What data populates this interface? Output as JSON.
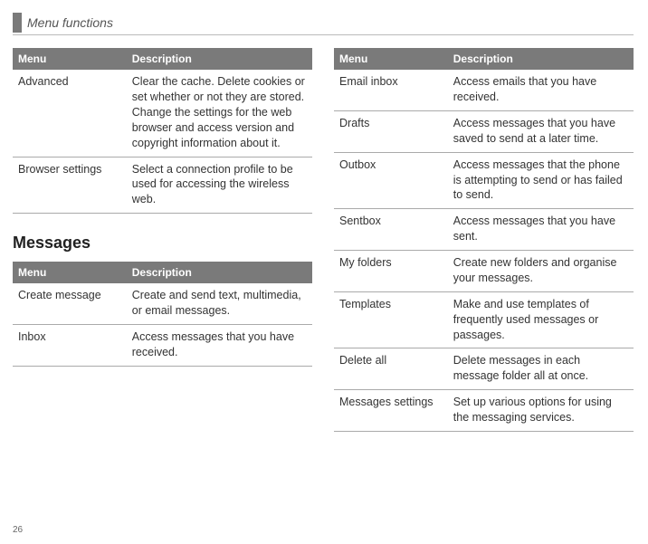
{
  "header": {
    "title": "Menu functions"
  },
  "page_number": "26",
  "table1": {
    "headers": {
      "menu": "Menu",
      "description": "Description"
    },
    "rows": [
      {
        "menu": "Advanced",
        "description": "Clear the cache. Delete cookies or set whether or not they are stored. Change the settings for the web browser and access version and copyright information about it."
      },
      {
        "menu": "Browser settings",
        "description": "Select a connection profile to be used for accessing the wireless web."
      }
    ]
  },
  "section_heading": "Messages",
  "table2": {
    "headers": {
      "menu": "Menu",
      "description": "Description"
    },
    "rows": [
      {
        "menu": "Create message",
        "description": "Create and send text, multimedia, or email messages."
      },
      {
        "menu": "Inbox",
        "description": "Access messages that you have received."
      }
    ]
  },
  "table3": {
    "headers": {
      "menu": "Menu",
      "description": "Description"
    },
    "rows": [
      {
        "menu": "Email inbox",
        "description": "Access emails that you have received."
      },
      {
        "menu": "Drafts",
        "description": "Access messages that you have saved to send at a later time."
      },
      {
        "menu": "Outbox",
        "description": "Access messages that the phone is attempting to send or has failed to send."
      },
      {
        "menu": "Sentbox",
        "description": "Access messages that you have sent."
      },
      {
        "menu": "My folders",
        "description": "Create new folders and organise your messages."
      },
      {
        "menu": "Templates",
        "description": "Make and use templates of frequently used messages or passages."
      },
      {
        "menu": "Delete all",
        "description": "Delete messages in each message folder all at once."
      },
      {
        "menu": "Messages settings",
        "description": "Set up various options for using the messaging services."
      }
    ]
  }
}
